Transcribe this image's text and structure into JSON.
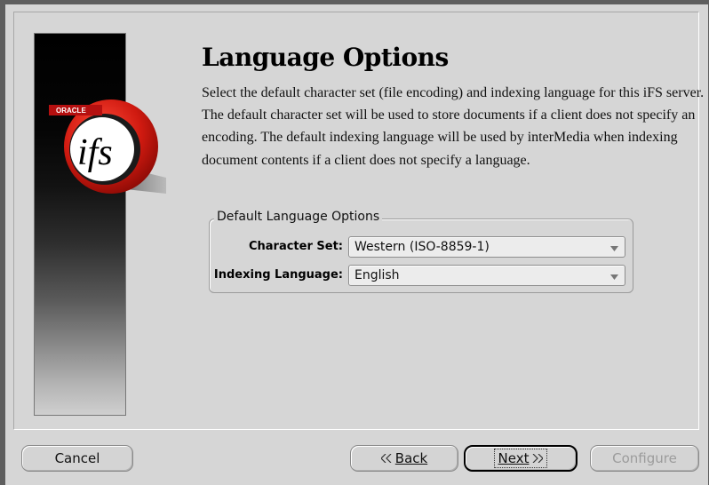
{
  "page": {
    "title": "Language Options",
    "description": "Select the default character set (file encoding) and indexing language for this iFS server. The default character set will be used to store documents if a client does not specify an encoding. The default indexing language will be used by interMedia when indexing document contents if a client does not specify a language."
  },
  "logo": {
    "brand": "ORACLE",
    "product": "ifs"
  },
  "group": {
    "title": "Default Language Options",
    "character_set": {
      "label": "Character Set:",
      "value": "Western (ISO-8859-1)"
    },
    "indexing_language": {
      "label": "Indexing Language:",
      "value": "English"
    }
  },
  "buttons": {
    "cancel": "Cancel",
    "back": "Back",
    "next": "Next",
    "configure": "Configure"
  },
  "icons": {
    "dropdown": "chevron-down-icon",
    "back": "double-chevron-left-icon",
    "next": "double-chevron-right-icon"
  },
  "colors": {
    "logo_red": "#cc1111",
    "background": "#d6d6d6"
  }
}
